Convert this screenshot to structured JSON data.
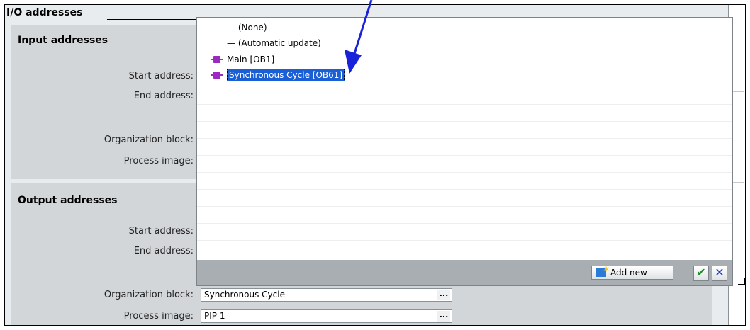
{
  "section": {
    "title": "I/O addresses"
  },
  "input_group": {
    "title": "Input addresses",
    "start_label": "Start address:",
    "end_label": "End address:",
    "ob_label": "Organization block:",
    "pi_label": "Process image:"
  },
  "output_group": {
    "title": "Output addresses",
    "start_label": "Start address:",
    "end_label": "End address:",
    "ob_label": "Organization block:",
    "ob_value": "Synchronous Cycle",
    "pi_label": "Process image:",
    "pi_value": "PIP 1",
    "browse_label": "..."
  },
  "dropdown": {
    "options": [
      {
        "dash": "—",
        "label": "(None)"
      },
      {
        "dash": "—",
        "label": "(Automatic update)"
      },
      {
        "icon": "organization-block-icon",
        "label": "Main [OB1]"
      },
      {
        "icon": "organization-block-icon",
        "label": "Synchronous Cycle [OB61]",
        "selected": true
      }
    ],
    "add_new_label": "Add new",
    "confirm_label": "✔",
    "cancel_label": "✕"
  },
  "colors": {
    "selection": "#1a5fd6",
    "ob_icon": "#9b2bc0",
    "annotation_arrow": "#1a22d9",
    "confirm": "#1e8c2a",
    "cancel": "#1a3fd0"
  }
}
